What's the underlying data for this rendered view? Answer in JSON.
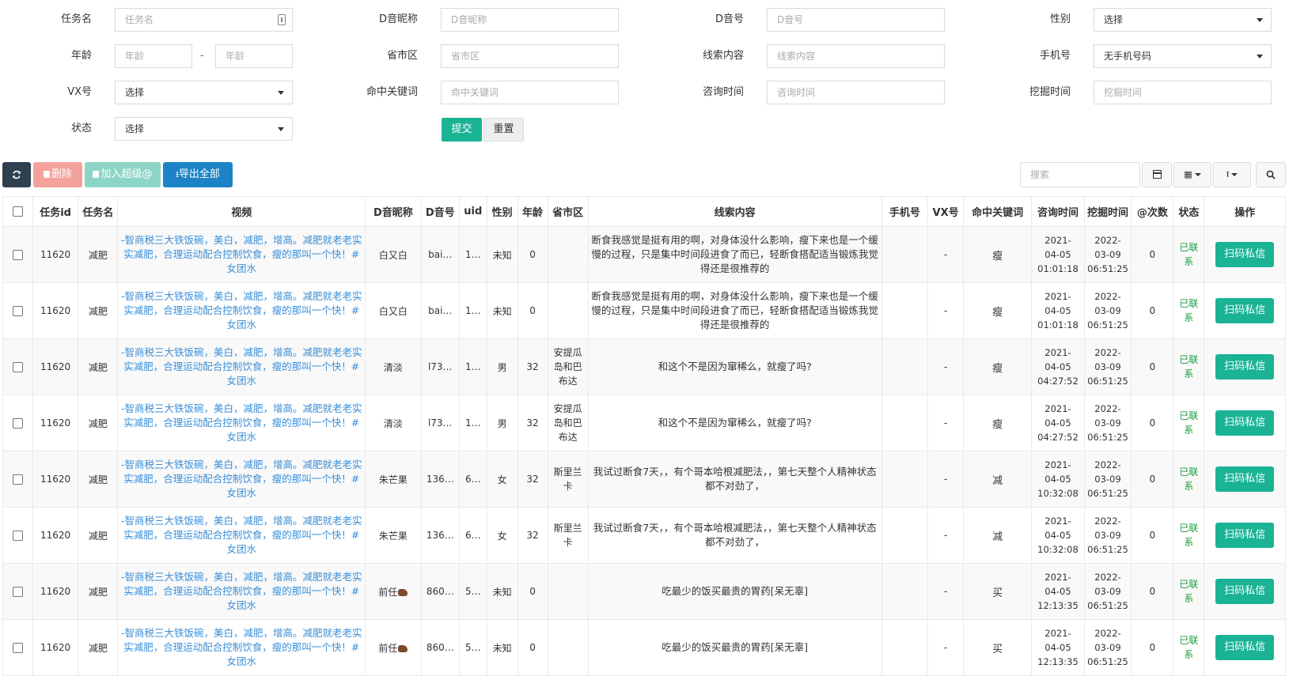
{
  "form": {
    "task_name": {
      "label": "任务名",
      "placeholder": "任务名"
    },
    "nickname": {
      "label": "D音昵称",
      "placeholder": "D音昵称"
    },
    "account": {
      "label": "D音号",
      "placeholder": "D音号"
    },
    "gender": {
      "label": "性别",
      "value": "选择"
    },
    "age": {
      "label": "年龄",
      "from_placeholder": "年龄",
      "separator": "-",
      "to_placeholder": "年龄"
    },
    "region": {
      "label": "省市区",
      "placeholder": "省市区"
    },
    "clue": {
      "label": "线索内容",
      "placeholder": "线索内容"
    },
    "phone": {
      "label": "手机号",
      "value": "无手机号码"
    },
    "vx": {
      "label": "VX号",
      "value": "选择"
    },
    "keyword": {
      "label": "命中关键词",
      "placeholder": "命中关键词"
    },
    "consult_time": {
      "label": "咨询时间",
      "placeholder": "咨询时间"
    },
    "mine_time": {
      "label": "挖掘时间",
      "placeholder": "挖掘时间"
    },
    "status": {
      "label": "状态",
      "value": "选择"
    },
    "submit_label": "提交",
    "reset_label": "重置"
  },
  "toolbar": {
    "delete_label": "删除",
    "super_label": "加入超级@",
    "export_label": "导出全部",
    "search_placeholder": "搜索"
  },
  "columns": [
    "任务id",
    "任务名",
    "视频",
    "D音昵称",
    "D音号",
    "uid",
    "性别",
    "年龄",
    "省市区",
    "线索内容",
    "手机号",
    "VX号",
    "命中关键词",
    "咨询时间",
    "挖掘时间",
    "@次数",
    "状态",
    "操作"
  ],
  "rows": [
    {
      "id": "11620",
      "task": "减肥",
      "video": "-智商税三大铁饭碗，美白，减肥，增高。减肥就老老实实减肥，合理运动配合控制饮食，瘦的那叫一个快！#女团水",
      "nick": "白又白",
      "acct": "bai…",
      "uid": "1…",
      "gender": "未知",
      "age": "0",
      "region": "",
      "clue": "断食我感觉是挺有用的啊，对身体没什么影响，瘦下来也是一个缓慢的过程，只是集中时间段进食了而已，轻断食搭配适当锻炼我觉得还是很推荐的",
      "phone": "",
      "vx": "-",
      "kw": "瘦",
      "consult": [
        "2021-",
        "04-05",
        "01:01:18"
      ],
      "mine": [
        "2022-",
        "03-09",
        "06:51:25"
      ],
      "at": "0",
      "status": "已联系",
      "op": "扫码私信"
    },
    {
      "id": "11620",
      "task": "减肥",
      "video": "-智商税三大铁饭碗，美白，减肥，增高。减肥就老老实实减肥，合理运动配合控制饮食，瘦的那叫一个快！#女团水",
      "nick": "白又白",
      "acct": "bai…",
      "uid": "1…",
      "gender": "未知",
      "age": "0",
      "region": "",
      "clue": "断食我感觉是挺有用的啊，对身体没什么影响，瘦下来也是一个缓慢的过程，只是集中时间段进食了而已，轻断食搭配适当锻炼我觉得还是很推荐的",
      "phone": "",
      "vx": "-",
      "kw": "瘦",
      "consult": [
        "2021-",
        "04-05",
        "01:01:18"
      ],
      "mine": [
        "2022-",
        "03-09",
        "06:51:25"
      ],
      "at": "0",
      "status": "已联系",
      "op": "扫码私信"
    },
    {
      "id": "11620",
      "task": "减肥",
      "video": "-智商税三大铁饭碗，美白，减肥，增高。减肥就老老实实减肥，合理运动配合控制饮食，瘦的那叫一个快！#女团水",
      "nick": "清淡",
      "acct": "l73…",
      "uid": "1…",
      "gender": "男",
      "age": "32",
      "region": "安提瓜岛和巴布达",
      "clue": "和这个不是因为窜稀么，就瘦了吗?",
      "phone": "",
      "vx": "-",
      "kw": "瘦",
      "consult": [
        "2021-",
        "04-05",
        "04:27:52"
      ],
      "mine": [
        "2022-",
        "03-09",
        "06:51:25"
      ],
      "at": "0",
      "status": "已联系",
      "op": "扫码私信"
    },
    {
      "id": "11620",
      "task": "减肥",
      "video": "-智商税三大铁饭碗，美白，减肥，增高。减肥就老老实实减肥，合理运动配合控制饮食，瘦的那叫一个快！#女团水",
      "nick": "清淡",
      "acct": "l73…",
      "uid": "1…",
      "gender": "男",
      "age": "32",
      "region": "安提瓜岛和巴布达",
      "clue": "和这个不是因为窜稀么，就瘦了吗?",
      "phone": "",
      "vx": "-",
      "kw": "瘦",
      "consult": [
        "2021-",
        "04-05",
        "04:27:52"
      ],
      "mine": [
        "2022-",
        "03-09",
        "06:51:25"
      ],
      "at": "0",
      "status": "已联系",
      "op": "扫码私信"
    },
    {
      "id": "11620",
      "task": "减肥",
      "video": "-智商税三大铁饭碗，美白，减肥，增高。减肥就老老实实减肥，合理运动配合控制饮食，瘦的那叫一个快！#女团水",
      "nick": "朱芒果",
      "acct": "136…",
      "uid": "6…",
      "gender": "女",
      "age": "32",
      "region": "斯里兰卡",
      "clue": "我试过断食7天，，有个哥本哈根减肥法，，第七天整个人精神状态都不对劲了，",
      "phone": "",
      "vx": "-",
      "kw": "减",
      "consult": [
        "2021-",
        "04-05",
        "10:32:08"
      ],
      "mine": [
        "2022-",
        "03-09",
        "06:51:25"
      ],
      "at": "0",
      "status": "已联系",
      "op": "扫码私信"
    },
    {
      "id": "11620",
      "task": "减肥",
      "video": "-智商税三大铁饭碗，美白，减肥，增高。减肥就老老实实减肥，合理运动配合控制饮食，瘦的那叫一个快！#女团水",
      "nick": "朱芒果",
      "acct": "136…",
      "uid": "6…",
      "gender": "女",
      "age": "32",
      "region": "斯里兰卡",
      "clue": "我试过断食7天，，有个哥本哈根减肥法，，第七天整个人精神状态都不对劲了，",
      "phone": "",
      "vx": "-",
      "kw": "减",
      "consult": [
        "2021-",
        "04-05",
        "10:32:08"
      ],
      "mine": [
        "2022-",
        "03-09",
        "06:51:25"
      ],
      "at": "0",
      "status": "已联系",
      "op": "扫码私信"
    },
    {
      "id": "11620",
      "task": "减肥",
      "video": "-智商税三大铁饭碗，美白，减肥，增高。减肥就老老实实减肥，合理运动配合控制饮食，瘦的那叫一个快！#女团水",
      "nick": "前任",
      "nick_emoji": true,
      "acct": "860…",
      "uid": "5…",
      "gender": "未知",
      "age": "0",
      "region": "",
      "clue": "吃最少的饭买最贵的胃药[呆无辜]",
      "phone": "",
      "vx": "-",
      "kw": "买",
      "consult": [
        "2021-",
        "04-05",
        "12:13:35"
      ],
      "mine": [
        "2022-",
        "03-09",
        "06:51:25"
      ],
      "at": "0",
      "status": "已联系",
      "op": "扫码私信"
    },
    {
      "id": "11620",
      "task": "减肥",
      "video": "-智商税三大铁饭碗，美白，减肥，增高。减肥就老老实实减肥，合理运动配合控制饮食，瘦的那叫一个快！#女团水",
      "nick": "前任",
      "nick_emoji": true,
      "acct": "860…",
      "uid": "5…",
      "gender": "未知",
      "age": "0",
      "region": "",
      "clue": "吃最少的饭买最贵的胃药[呆无辜]",
      "phone": "",
      "vx": "-",
      "kw": "买",
      "consult": [
        "2021-",
        "04-05",
        "12:13:35"
      ],
      "mine": [
        "2022-",
        "03-09",
        "06:51:25"
      ],
      "at": "0",
      "status": "已联系",
      "op": "扫码私信"
    }
  ]
}
